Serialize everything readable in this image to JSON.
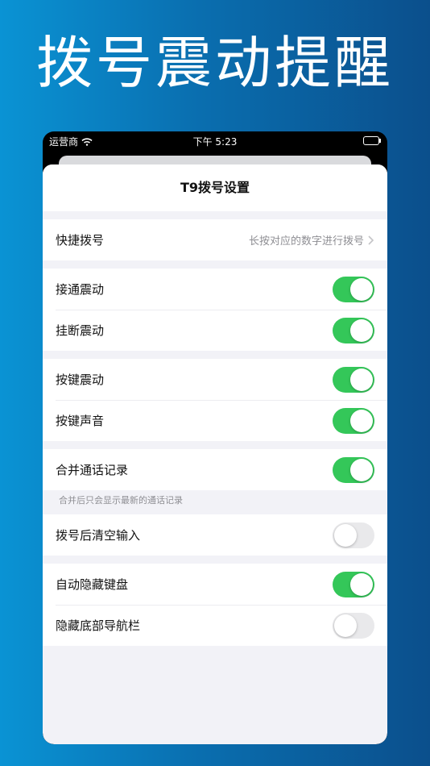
{
  "headline": "拨号震动提醒",
  "status_bar": {
    "carrier": "运营商",
    "time": "下午 5:23"
  },
  "sheet": {
    "title": "T9拨号设置"
  },
  "quick_dial": {
    "label": "快捷拨号",
    "detail": "长按对应的数字进行拨号"
  },
  "connect_vibrate": {
    "label": "接通震动",
    "on": true
  },
  "hangup_vibrate": {
    "label": "挂断震动",
    "on": true
  },
  "key_vibrate": {
    "label": "按键震动",
    "on": true
  },
  "key_sound": {
    "label": "按键声音",
    "on": true
  },
  "merge_logs": {
    "label": "合并通话记录",
    "on": true,
    "footnote": "合并后只会显示最新的通话记录"
  },
  "clear_input": {
    "label": "拨号后清空输入",
    "on": false
  },
  "auto_hide_keyboard": {
    "label": "自动隐藏键盘",
    "on": true
  },
  "hide_navbar": {
    "label": "隐藏底部导航栏",
    "on": false
  },
  "colors": {
    "toggle_on": "#34c759",
    "toggle_off": "#e9e9eb"
  }
}
